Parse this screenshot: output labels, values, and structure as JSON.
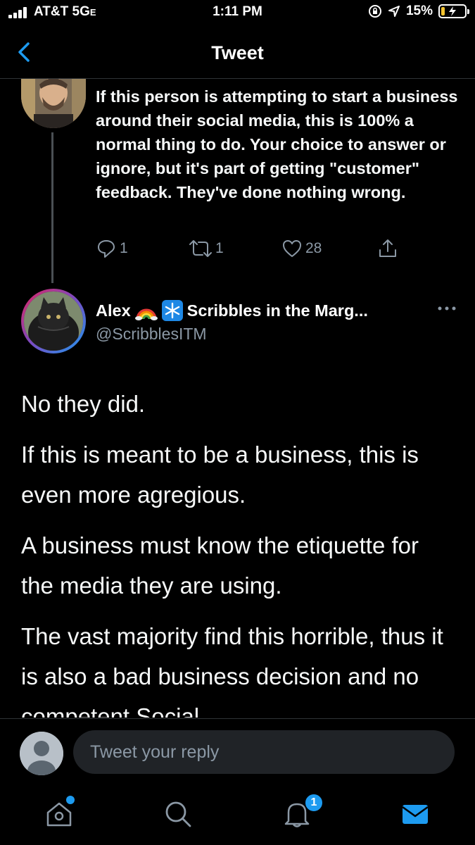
{
  "status_bar": {
    "carrier": "AT&T  5G",
    "network_suffix": "E",
    "time": "1:11 PM",
    "battery_percent": "15%",
    "battery_level": 0.15
  },
  "header": {
    "title": "Tweet"
  },
  "parent_tweet": {
    "text": "If this person is attempting to start a business around their social media, this is 100% a normal thing to do. Your choice to answer or ignore, but it's part of getting \"customer\" feedback. They've done nothing wrong.",
    "replies": "1",
    "retweets": "1",
    "likes": "28"
  },
  "reply_tweet": {
    "display_name": "Alex",
    "name_suffix": "Scribbles in the Marg...",
    "handle": "@ScribblesITM",
    "paragraphs": [
      "No they did.",
      "If this is meant to be a business, this is even more agregious.",
      "A business must know the etiquette for the media they are using.",
      "The vast majority find this horrible, thus it is also a bad business decision and no competent Social"
    ]
  },
  "composer": {
    "placeholder": "Tweet your reply"
  },
  "tab_bar": {
    "notifications_badge": "1"
  },
  "colors": {
    "accent": "#1d9bf0",
    "muted": "#8b98a5",
    "background": "#000000"
  }
}
